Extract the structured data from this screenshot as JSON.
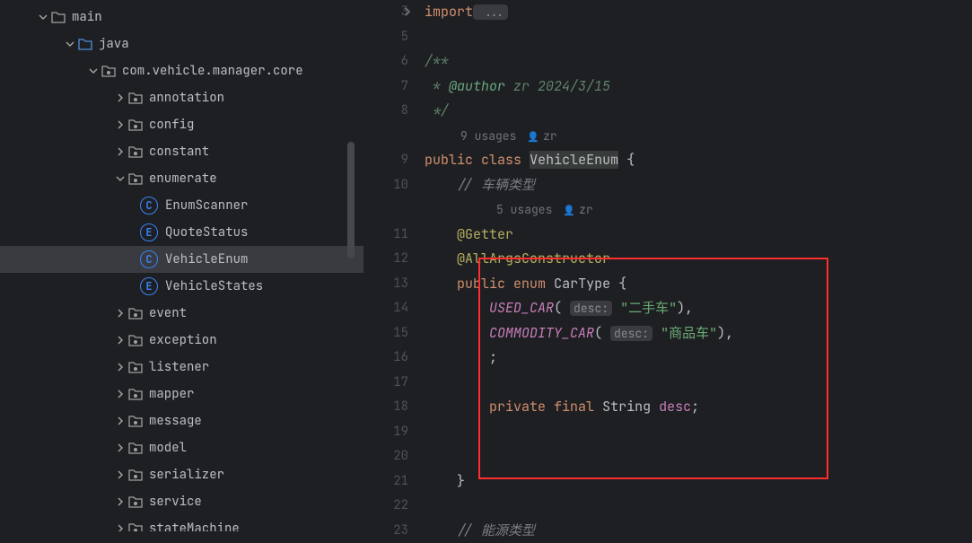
{
  "tree": {
    "main": "main",
    "java": "java",
    "package": "com.vehicle.manager.core",
    "annotation": "annotation",
    "config": "config",
    "constant": "constant",
    "enumerate": "enumerate",
    "enumScanner": "EnumScanner",
    "quoteStatus": "QuoteStatus",
    "vehicleEnum": "VehicleEnum",
    "vehicleStates": "VehicleStates",
    "event": "event",
    "exception": "exception",
    "listener": "listener",
    "mapper": "mapper",
    "message": "message",
    "model": "model",
    "serializer": "serializer",
    "service": "service",
    "stateMachine": "stateMachine"
  },
  "gutter": [
    "3",
    "5",
    "6",
    "7",
    "8",
    "9",
    "10",
    "11",
    "12",
    "13",
    "14",
    "15",
    "16",
    "17",
    "18",
    "19",
    "20",
    "21",
    "22",
    "23"
  ],
  "code": {
    "import_kw": "import",
    "import_ellipsis": " ...",
    "doc_open": "/**",
    "doc_author": " * ",
    "doc_author_tag": "@author",
    "doc_author_val": " zr 2024/3/15",
    "doc_close": " */",
    "usages9": "9 usages",
    "author9": "zr",
    "public_kw": "public",
    "class_kw": "class",
    "class_name": "VehicleEnum",
    "brace_open": " {",
    "comment_type": "// 车辆类型",
    "usages5": "5 usages",
    "author5": "zr",
    "ann_getter": "@Getter",
    "ann_all": "@AllArgsConstructor",
    "enum_kw": "enum",
    "enum_name": "CarType",
    "used_car": "USED_CAR",
    "desc_hint": "desc:",
    "used_car_str": "\"二手车\"",
    "commodity_car": "COMMODITY_CAR",
    "commodity_car_str": "\"商品车\"",
    "semicolon": ";",
    "private_kw": "private",
    "final_kw": "final",
    "string_type": "String",
    "desc_field": "desc",
    "brace_close": "}",
    "comment_energy": "// 能源类型"
  }
}
